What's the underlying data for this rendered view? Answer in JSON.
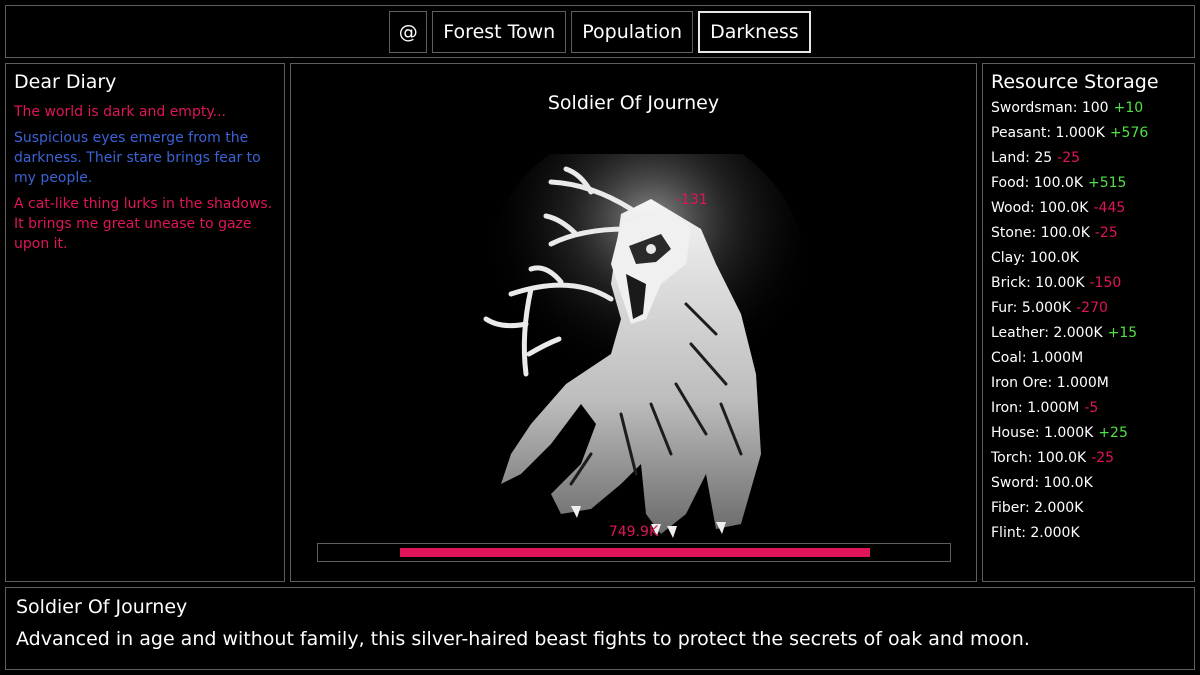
{
  "tabs": [
    "@",
    "Forest Town",
    "Population",
    "Darkness"
  ],
  "active_tab": "Darkness",
  "diary": {
    "title": "Dear Diary",
    "entries": [
      {
        "text": "The world is dark and empty...",
        "color": "#e0145a"
      },
      {
        "text": "Suspicious eyes emerge from the darkness. Their stare brings fear to my people.",
        "color": "#3b63d6"
      },
      {
        "text": "A cat-like thing lurks in the shadows. It brings me great unease to gaze upon it.",
        "color": "#e0145a"
      }
    ]
  },
  "enemy": {
    "name": "Soldier Of Journey",
    "damage_popup": "-131",
    "hp_label": "749.9K",
    "hp_fraction": 0.74,
    "image_icon": "wolf-beast-icon"
  },
  "resources": {
    "title": "Resource Storage",
    "items": [
      {
        "name": "Swordsman",
        "amount": "100",
        "delta": "+10"
      },
      {
        "name": "Peasant",
        "amount": "1.000K",
        "delta": "+576"
      },
      {
        "name": "Land",
        "amount": "25",
        "delta": "-25"
      },
      {
        "name": "Food",
        "amount": "100.0K",
        "delta": "+515"
      },
      {
        "name": "Wood",
        "amount": "100.0K",
        "delta": "-445"
      },
      {
        "name": "Stone",
        "amount": "100.0K",
        "delta": "-25"
      },
      {
        "name": "Clay",
        "amount": "100.0K",
        "delta": ""
      },
      {
        "name": "Brick",
        "amount": "10.00K",
        "delta": "-150"
      },
      {
        "name": "Fur",
        "amount": "5.000K",
        "delta": "-270"
      },
      {
        "name": "Leather",
        "amount": "2.000K",
        "delta": "+15"
      },
      {
        "name": "Coal",
        "amount": "1.000M",
        "delta": ""
      },
      {
        "name": "Iron Ore",
        "amount": "1.000M",
        "delta": ""
      },
      {
        "name": "Iron",
        "amount": "1.000M",
        "delta": "-5"
      },
      {
        "name": "House",
        "amount": "1.000K",
        "delta": "+25"
      },
      {
        "name": "Torch",
        "amount": "100.0K",
        "delta": "-25"
      },
      {
        "name": "Sword",
        "amount": "100.0K",
        "delta": ""
      },
      {
        "name": "Fiber",
        "amount": "2.000K",
        "delta": ""
      },
      {
        "name": "Flint",
        "amount": "2.000K",
        "delta": ""
      }
    ]
  },
  "info": {
    "title": "Soldier Of Journey",
    "description": "Advanced in age and without family, this silver-haired beast fights to protect the secrets of oak and moon."
  },
  "colors": {
    "accent_red": "#e0145a",
    "accent_blue": "#3b63d6",
    "positive_green": "#52e046",
    "border": "#5e5e5e"
  }
}
